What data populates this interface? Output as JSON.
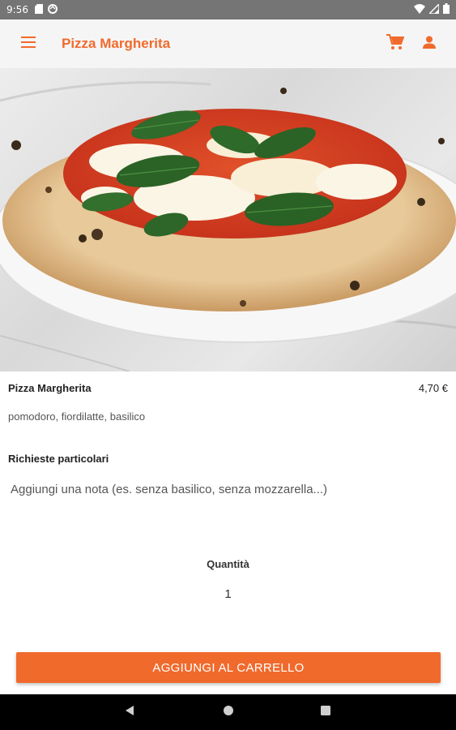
{
  "status_bar": {
    "time": "9:56",
    "left_icons": [
      "sd-card-icon",
      "data-saver-icon"
    ],
    "right_icons": [
      "wifi-icon",
      "signal-icon",
      "battery-icon"
    ]
  },
  "app_bar": {
    "title": "Pizza Margherita",
    "menu_icon": "menu-icon",
    "cart_icon": "cart-icon",
    "account_icon": "account-icon",
    "accent_color": "#f06a2c"
  },
  "product": {
    "name": "Pizza Margherita",
    "price": "4,70 €",
    "description": "pomodoro, fiordilatte, basilico"
  },
  "requests": {
    "label": "Richieste particolari",
    "placeholder": "Aggiungi una nota (es. senza basilico, senza mozzarella...)",
    "value": ""
  },
  "quantity": {
    "label": "Quantità",
    "value": "1"
  },
  "add_button": {
    "label": "AGGIUNGI AL CARRELLO",
    "color": "#f06a2c"
  },
  "nav_bar": {
    "back_icon": "back-icon",
    "home_icon": "home-icon",
    "recents_icon": "recents-icon"
  }
}
